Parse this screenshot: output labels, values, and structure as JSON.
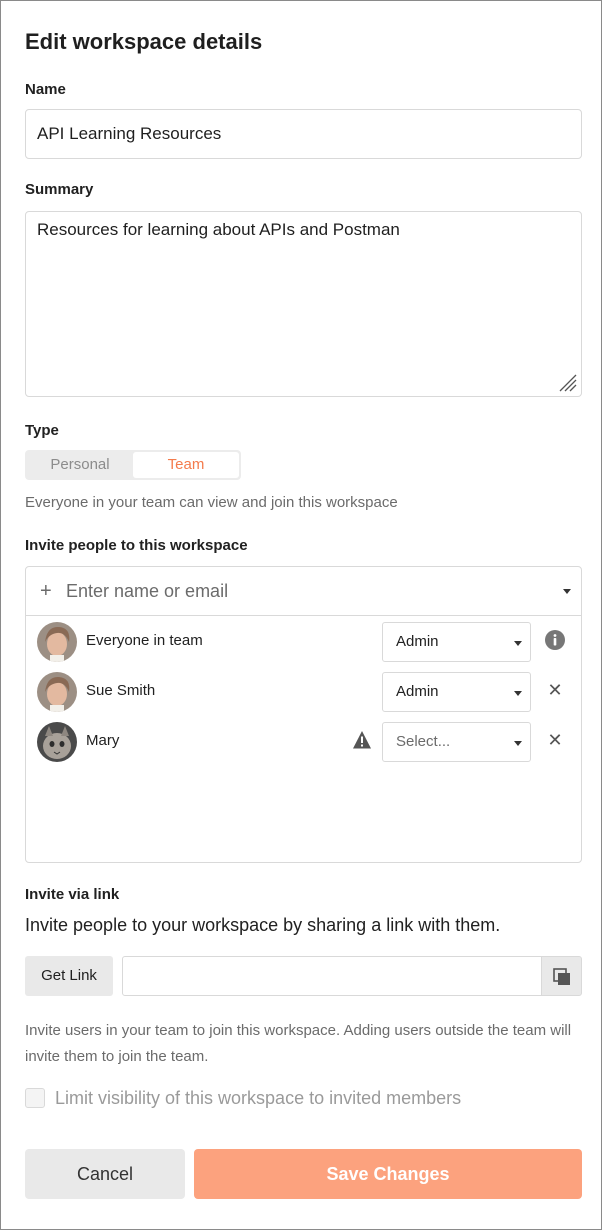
{
  "dialog": {
    "title": "Edit workspace details"
  },
  "name": {
    "label": "Name",
    "value": "API Learning Resources"
  },
  "summary": {
    "label": "Summary",
    "value": "Resources for learning about APIs and Postman"
  },
  "type": {
    "label": "Type",
    "options": [
      "Personal",
      "Team"
    ],
    "selected": "Team",
    "hint": "Everyone in your team can view and join this workspace"
  },
  "invite": {
    "label": "Invite people to this workspace",
    "placeholder": "Enter name or email",
    "members": [
      {
        "name": "Everyone in team",
        "role": "Admin",
        "action_icon": "info-icon"
      },
      {
        "name": "Sue Smith",
        "role": "Admin",
        "action_icon": "close-icon"
      },
      {
        "name": "Mary",
        "role": "Select...",
        "warning_icon": "warning-icon",
        "action_icon": "close-icon"
      }
    ]
  },
  "invite_link": {
    "label": "Invite via link",
    "description": "Invite people to your workspace by sharing a link with them.",
    "get_link_label": "Get Link",
    "link_value": "",
    "note": "Invite users in your team to join this workspace. Adding users outside the team will invite them to join the team."
  },
  "visibility": {
    "label": "Limit visibility of this workspace to invited members",
    "checked": false
  },
  "actions": {
    "cancel_label": "Cancel",
    "save_label": "Save Changes"
  },
  "colors": {
    "accent": "#f47b4c",
    "save_button": "#fca27e"
  }
}
